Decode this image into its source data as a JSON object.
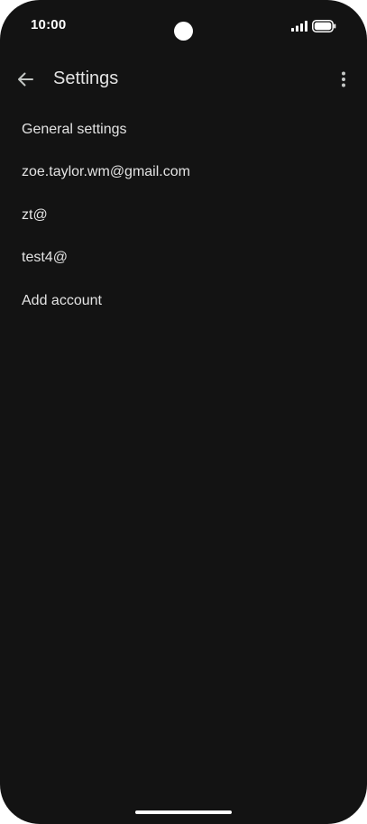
{
  "status_bar": {
    "time": "10:00",
    "icons": [
      "signal-icon",
      "battery-icon"
    ]
  },
  "app_bar": {
    "title": "Settings",
    "back_icon": "arrow-back-icon",
    "more_icon": "more-vert-icon"
  },
  "settings": {
    "items": [
      {
        "label": "General settings"
      },
      {
        "label": "zoe.taylor.wm@gmail.com"
      },
      {
        "label": "zt@"
      },
      {
        "label": "test4@"
      },
      {
        "label": "Add account"
      }
    ]
  },
  "colors": {
    "background": "#131313",
    "text": "#e3e3e3",
    "status_text": "#ffffff"
  }
}
